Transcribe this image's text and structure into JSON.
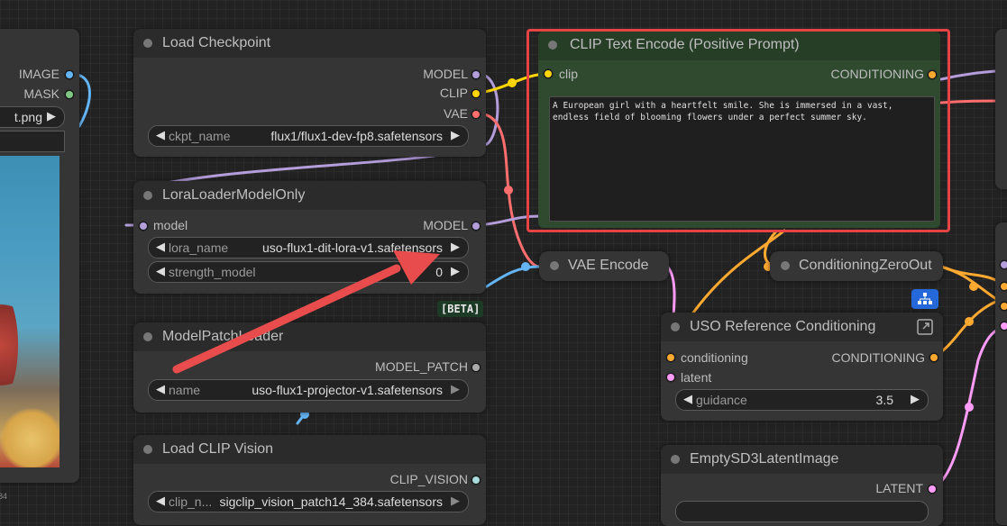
{
  "nodes": {
    "load_image": {
      "outputs": [
        "IMAGE",
        "MASK"
      ],
      "image_widget_text": "t.png",
      "footer_text": "84"
    },
    "load_checkpoint": {
      "title": "Load Checkpoint",
      "outputs": [
        "MODEL",
        "CLIP",
        "VAE"
      ],
      "ckpt_name_label": "ckpt_name",
      "ckpt_name_value": "flux1/flux1-dev-fp8.safetensors"
    },
    "lora_loader": {
      "title": "LoraLoaderModelOnly",
      "input": "model",
      "output": "MODEL",
      "lora_name_label": "lora_name",
      "lora_name_value": "uso-flux1-dit-lora-v1.safetensors",
      "strength_label": "strength_model",
      "strength_value": "0"
    },
    "model_patch_loader": {
      "title": "ModelPatchLoader",
      "beta_badge": "[BETA]",
      "output": "MODEL_PATCH",
      "name_label": "name",
      "name_value": "uso-flux1-projector-v1.safetensors"
    },
    "load_clip_vision": {
      "title": "Load CLIP Vision",
      "output": "CLIP_VISION",
      "clip_name_label": "clip_n...",
      "clip_name_value": "sigclip_vision_patch14_384.safetensors"
    },
    "clip_text_encode": {
      "title": "CLIP Text Encode (Positive Prompt)",
      "input": "clip",
      "output": "CONDITIONING",
      "prompt": "A European girl with a heartfelt smile. She is immersed in a vast, endless field of blooming flowers under a perfect summer sky."
    },
    "vae_encode": {
      "title": "VAE Encode"
    },
    "conditioning_zero_out": {
      "title": "ConditioningZeroOut"
    },
    "uso_reference": {
      "title": "USO Reference Conditioning",
      "inputs": [
        "conditioning",
        "latent"
      ],
      "output": "CONDITIONING",
      "guidance_label": "guidance",
      "guidance_value": "3.5"
    },
    "empty_latent": {
      "title": "EmptySD3LatentImage",
      "output": "LATENT"
    }
  },
  "colors": {
    "model": "#b39ddb",
    "clip": "#ffd500",
    "vae": "#ff6e6e",
    "conditioning": "#ffa931",
    "latent": "#ff9cf9",
    "image": "#64b5f6",
    "mask": "#81c784",
    "clip_vision": "#a8dadc",
    "model_patch": "#aaaaaa",
    "highlight_border": "#e64444",
    "annotation_arrow": "#e84c4c",
    "positive_node_bg": "#2f4a2f",
    "beta_badge_bg": "#1c3a25",
    "blue_button": "#2468d9"
  },
  "icons": {
    "node_dot": "circle-dot-icon",
    "expand": "expand-icon",
    "hierarchy": "hierarchy-icon",
    "arrow_left": "triangle-left-icon",
    "arrow_right": "triangle-right-icon"
  }
}
